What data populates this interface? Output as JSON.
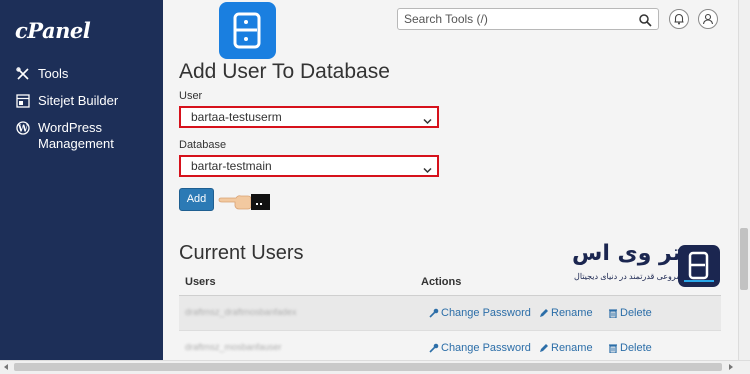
{
  "sidebar": {
    "logo": "cPanel",
    "items": [
      {
        "label": "Tools"
      },
      {
        "label": "Sitejet Builder"
      },
      {
        "label": "WordPress Management"
      }
    ]
  },
  "topbar": {
    "search_placeholder": "Search Tools (/)"
  },
  "form": {
    "title": "Add User To Database",
    "user_label": "User",
    "user_value": "bartaa-testuserm",
    "database_label": "Database",
    "database_value": "bartar-testmain",
    "add_label": "Add"
  },
  "current_users": {
    "title": "Current Users",
    "headers": {
      "users": "Users",
      "actions": "Actions"
    },
    "rows": [
      {
        "user": "draftmsz_draftmosbanfadex",
        "change_password": "Change Password",
        "rename": "Rename",
        "delete": "Delete"
      },
      {
        "user": "draftmsz_mosbanfauser",
        "change_password": "Change Password",
        "rename": "Rename",
        "delete": "Delete"
      }
    ]
  },
  "watermark": {
    "title": "برتر وی اس",
    "subtitle": "شروعی قدرتمند در دنیای دیجیتال"
  },
  "colors": {
    "sidebar_bg": "#1d2f58",
    "accent": "#2c7ab5",
    "highlight_border": "#d6111b",
    "link": "#2c6ea8"
  }
}
